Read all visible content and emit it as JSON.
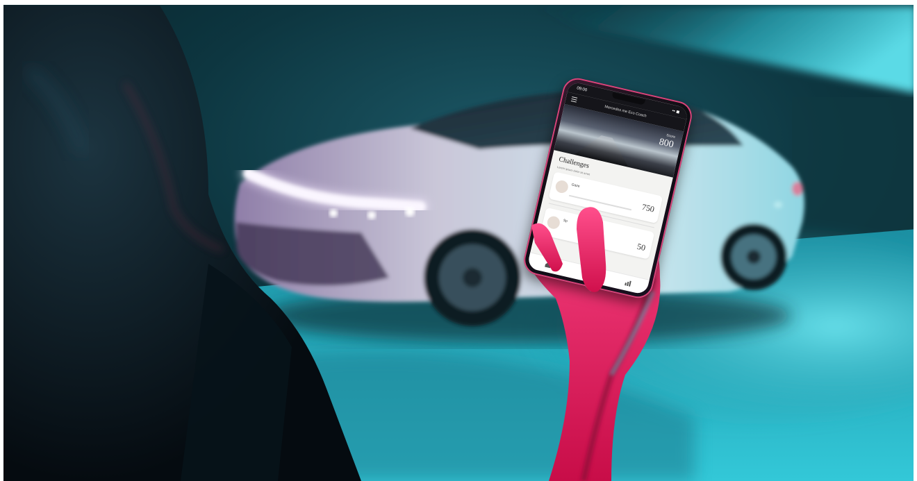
{
  "scene": {
    "description_colors": {
      "background_teal": "#1fa8b8",
      "dark_teal": "#0f3a44",
      "magenta_light": "#e0185a",
      "car_body": "#d9e4ea"
    }
  },
  "phone": {
    "status_time": "09:00",
    "status_icons": "▪▪ ◼",
    "app_title": "Mercedes me Eco Coach",
    "hero": {
      "score_label": "Score",
      "score_value": "800"
    },
    "section_title": "Challenges",
    "section_subtitle": "Lorem ipsum dolor sit amet",
    "cards": [
      {
        "name": "Gaze",
        "value": "750"
      },
      {
        "name": "Sp",
        "value": "50"
      }
    ]
  }
}
